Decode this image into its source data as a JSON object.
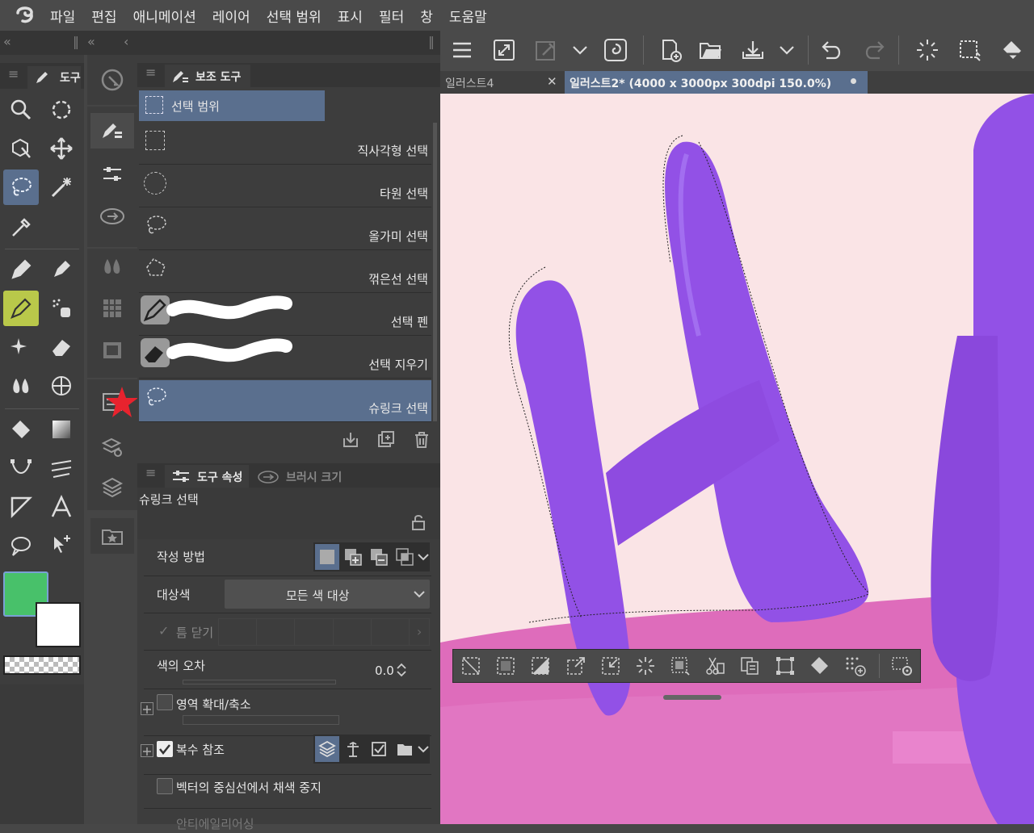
{
  "menu": [
    "파일",
    "편집",
    "애니메이션",
    "레이어",
    "선택 범위",
    "표시",
    "필터",
    "창",
    "도움말"
  ],
  "tool_panel": {
    "tab_label": "도구"
  },
  "subtool_panel": {
    "tab_label": "보조 도구",
    "group_label": "선택 범위",
    "items": [
      {
        "name": "직사각형 선택",
        "icon": "rect-select-icon"
      },
      {
        "name": "타원 선택",
        "icon": "ellipse-select-icon"
      },
      {
        "name": "올가미 선택",
        "icon": "lasso-icon"
      },
      {
        "name": "꺾은선 선택",
        "icon": "polyline-select-icon"
      },
      {
        "name": "선택 펜",
        "icon": "selection-pen-icon"
      },
      {
        "name": "선택 지우기",
        "icon": "selection-eraser-icon"
      },
      {
        "name": "슈링크 선택",
        "icon": "shrink-lasso-icon"
      }
    ],
    "selected_index": 6
  },
  "property_panel": {
    "tab_label": "도구 속성",
    "tab2_label": "브러시 크기",
    "tool_name": "슈링크 선택",
    "creation_method_label": "작성 방법",
    "target_color_label": "대상색",
    "target_color_value": "모든 색 대상",
    "close_gap_label": "틈 닫기",
    "color_tolerance_label": "색의 오차",
    "color_tolerance_value": "0.0",
    "area_scaling_label": "영역 확대/축소",
    "multi_reference_label": "복수 참조",
    "vector_center_label": "벡터의 중심선에서 채색 중지",
    "cutoff_label": "안티에일리어싱"
  },
  "document_tabs": [
    {
      "label": "일러스트4",
      "active": false
    },
    {
      "label": "일러스트2* (4000 x 3000px 300dpi 150.0%)",
      "active": true
    }
  ],
  "colors": {
    "main_color": "#48c16a",
    "sub_color": "#ffffff",
    "accent": "#5a6f8e",
    "canvas_bg": "#fae4e6",
    "stroke_purple": "#9251e6",
    "ground_pink": "#de6cbb"
  }
}
